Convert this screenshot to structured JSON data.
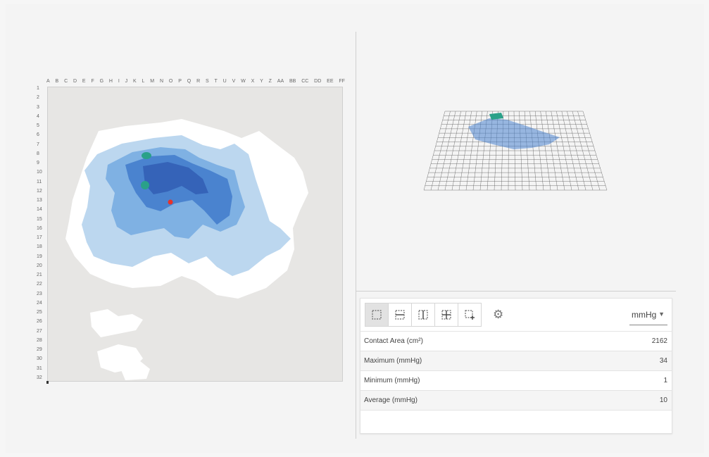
{
  "grid": {
    "columns": [
      "A",
      "B",
      "C",
      "D",
      "E",
      "F",
      "G",
      "H",
      "I",
      "J",
      "K",
      "L",
      "M",
      "N",
      "O",
      "P",
      "Q",
      "R",
      "S",
      "T",
      "U",
      "V",
      "W",
      "X",
      "Y",
      "Z",
      "AA",
      "BB",
      "CC",
      "DD",
      "EE",
      "FF"
    ],
    "rows": [
      "1",
      "2",
      "3",
      "4",
      "5",
      "6",
      "7",
      "8",
      "9",
      "10",
      "11",
      "12",
      "13",
      "14",
      "15",
      "16",
      "17",
      "18",
      "19",
      "20",
      "21",
      "22",
      "23",
      "24",
      "25",
      "26",
      "27",
      "28",
      "29",
      "30",
      "31",
      "32"
    ]
  },
  "colors": {
    "level_low": "#ffffff",
    "level_1": "#bcd7ef",
    "level_2": "#7fb1e3",
    "level_3": "#4a83cf",
    "level_4": "#3563b8",
    "level_peak": "#2aa189",
    "marker": "#e8322a"
  },
  "toolbar": {
    "tools": [
      {
        "icon": "select-rect-icon"
      },
      {
        "icon": "split-horizontal-icon"
      },
      {
        "icon": "split-vertical-icon"
      },
      {
        "icon": "split-quad-icon"
      },
      {
        "icon": "add-region-icon"
      }
    ],
    "settings_icon": "gear-icon",
    "unit": "mmHg"
  },
  "stats": [
    {
      "label": "Contact Area (cm²)",
      "value": "2162"
    },
    {
      "label": "Maximum (mmHg)",
      "value": "34"
    },
    {
      "label": "Minimum (mmHg)",
      "value": "1"
    },
    {
      "label": "Average (mmHg)",
      "value": "10"
    }
  ]
}
